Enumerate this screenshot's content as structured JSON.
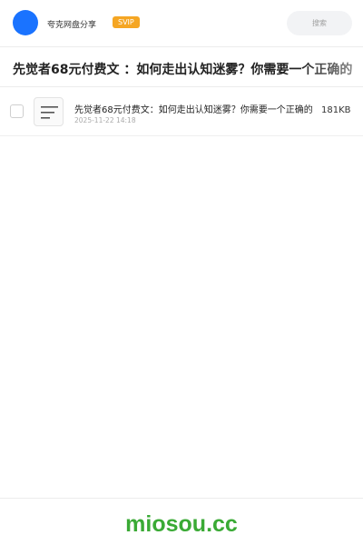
{
  "header": {
    "app_name": "夸克网盘分享",
    "badge": "SVIP",
    "search_placeholder": "搜索",
    "colors": {
      "avatar": "#1a73ff",
      "badge": "#f5a623"
    }
  },
  "title": "先觉者68元付费文 ：如何走出认知迷雾？你需要一个正确的",
  "files": [
    {
      "icon": "document-icon",
      "name": "先觉者68元付费文：如何走出认知迷雾？你需要一个正确的",
      "date": "2025-11-22 14:18",
      "size": "181KB"
    }
  ],
  "footer": {
    "brand": "miosou.cc",
    "brand_color": "#3aaa35"
  }
}
